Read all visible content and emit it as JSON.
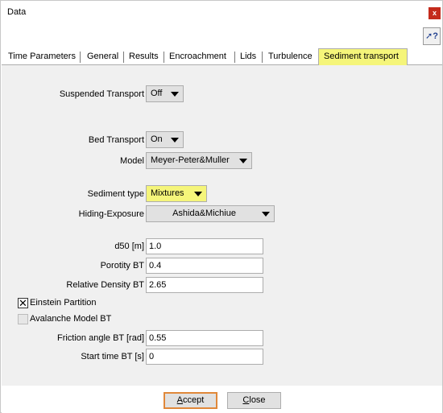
{
  "window": {
    "title": "Data",
    "close_label": "x",
    "help_label": "?"
  },
  "tabs": [
    {
      "label": "Time Parameters"
    },
    {
      "label": "General"
    },
    {
      "label": "Results"
    },
    {
      "label": "Encroachment"
    },
    {
      "label": "Lids"
    },
    {
      "label": "Turbulence"
    },
    {
      "label": "Sediment transport",
      "active": true
    }
  ],
  "sediment": {
    "suspended_transport": {
      "label": "Suspended Transport",
      "value": "Off"
    },
    "bed_transport": {
      "label": "Bed Transport",
      "value": "On"
    },
    "model": {
      "label": "Model",
      "value": "Meyer-Peter&Muller"
    },
    "sediment_type": {
      "label": "Sediment type",
      "value": "Mixtures"
    },
    "hiding_exposure": {
      "label": "Hiding-Exposure",
      "value": "Ashida&Michiue"
    },
    "d50": {
      "label": "d50 [m]",
      "value": "1.0"
    },
    "porosity": {
      "label": "Porotity BT",
      "value": "0.4"
    },
    "relative_density": {
      "label": "Relative Density BT",
      "value": "2.65"
    },
    "einstein_partition": {
      "label": "Einstein Partition",
      "checked": true,
      "mark": "✕"
    },
    "avalanche_model": {
      "label": "Avalanche Model BT",
      "checked": false
    },
    "friction_angle": {
      "label": "Friction angle BT [rad]",
      "value": "0.55"
    },
    "start_time": {
      "label": "Start time BT [s]",
      "value": "0"
    }
  },
  "buttons": {
    "accept_first": "A",
    "accept_rest": "ccept",
    "close_first": "C",
    "close_rest": "lose"
  },
  "colors": {
    "highlight": "#f5f57a",
    "close_red": "#c42b1c",
    "default_border": "#e0883a"
  }
}
